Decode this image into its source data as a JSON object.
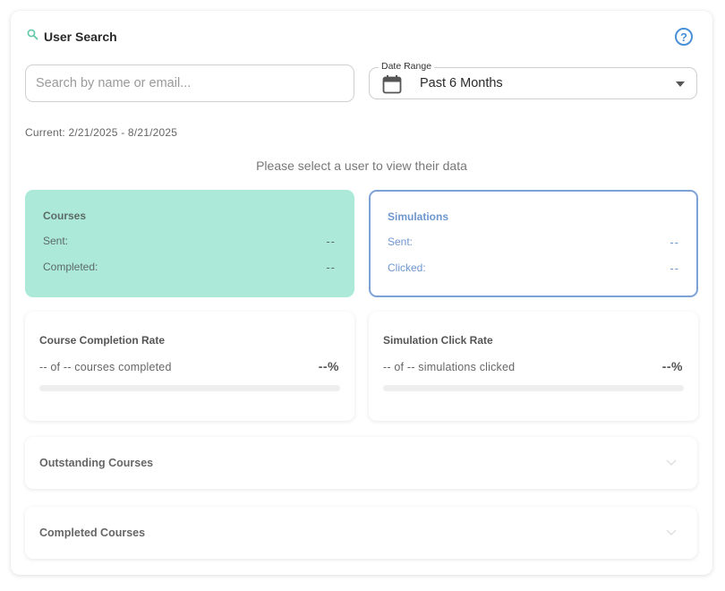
{
  "header": {
    "title": "User Search",
    "help_icon": "question-circle-icon"
  },
  "search": {
    "placeholder": "Search by name or email...",
    "value": ""
  },
  "date_range": {
    "label": "Date Range",
    "selected": "Past 6 Months"
  },
  "current_range": "Current: 2/21/2025 - 8/21/2025",
  "prompt": "Please select a user to view their data",
  "courses_card": {
    "title": "Courses",
    "sent_label": "Sent:",
    "sent_value": "--",
    "completed_label": "Completed:",
    "completed_value": "--",
    "color": "#ade9d8"
  },
  "simulations_card": {
    "title": "Simulations",
    "sent_label": "Sent:",
    "sent_value": "--",
    "clicked_label": "Clicked:",
    "clicked_value": "--",
    "color": "#7ca2d6"
  },
  "course_rate": {
    "title": "Course Completion Rate",
    "subtitle": "-- of -- courses completed",
    "percent": "--%",
    "progress": 0
  },
  "sim_rate": {
    "title": "Simulation Click Rate",
    "subtitle": "-- of -- simulations clicked",
    "percent": "--%",
    "progress": 0
  },
  "accordions": [
    {
      "title": "Outstanding Courses"
    },
    {
      "title": "Completed Courses"
    }
  ]
}
